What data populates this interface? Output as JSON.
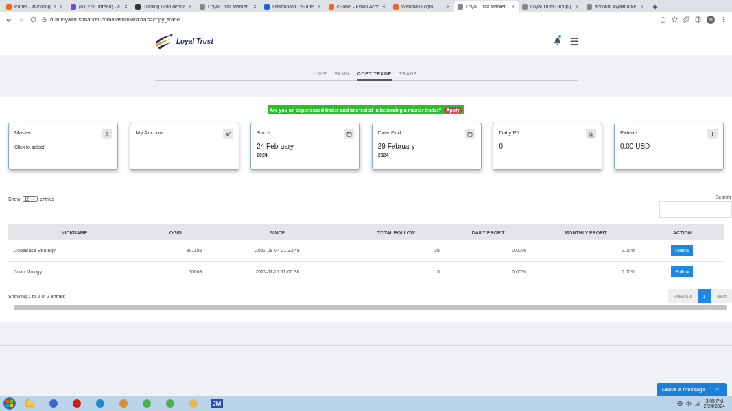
{
  "browser": {
    "tabs": [
      {
        "title": "Paper - Invoicing, In",
        "selected": false
      },
      {
        "title": "(61,221 unread) - a",
        "selected": false
      },
      {
        "title": "Trading Gold denga",
        "selected": false
      },
      {
        "title": "Loyal Trust Market",
        "selected": false
      },
      {
        "title": "Dashboard | hPanel",
        "selected": false
      },
      {
        "title": "cPanel - Email Acco",
        "selected": false
      },
      {
        "title": "Webmail Login",
        "selected": false
      },
      {
        "title": "Loyal Trust Market",
        "selected": true
      },
      {
        "title": "Loyal Trust Group |",
        "selected": false
      },
      {
        "title": "account.loyalmarke",
        "selected": false
      }
    ],
    "url": "hub.loyaltrustmarket.com/dashboard?tab=copy_trade",
    "profile": "M"
  },
  "header": {
    "brand": "Loyal Trust"
  },
  "nav": [
    {
      "label": "LIVE",
      "selected": false
    },
    {
      "label": "PAMM",
      "selected": false
    },
    {
      "label": "COPY TRADE",
      "selected": true
    },
    {
      "label": "TRADE",
      "selected": false
    }
  ],
  "banner": {
    "text": "Are you an experienced trader and interested in becoming a master trader?",
    "button": "Apply"
  },
  "cards": [
    {
      "title": "Master",
      "value": "Click to select",
      "kind": "user"
    },
    {
      "title": "My Account",
      "value": "-",
      "kind": "rocket"
    },
    {
      "title": "Since",
      "value": "24 February",
      "sub": "2024",
      "kind": "calendar"
    },
    {
      "title": "Date End",
      "value": "29 February",
      "sub": "2024",
      "kind": "calendar"
    },
    {
      "title": "Daily P/L",
      "value": "0",
      "kind": "chart"
    },
    {
      "title": "Extend",
      "value": "0.00 USD",
      "kind": "plus"
    }
  ],
  "table": {
    "show_label": "Show",
    "page_size": "10",
    "entries_label": "entries",
    "search_label": "Search:",
    "columns": [
      "NICKNAME",
      "LOGIN",
      "SINCE",
      "TOTAL FOLLOW",
      "DAILY PROFIT",
      "MONTHLY PROFIT",
      "ACTION"
    ],
    "rows": [
      {
        "nickname": "CodeBase Strategy",
        "login": "901152",
        "since": "2023-08-04 21:33:45",
        "total_follow": "36",
        "daily_profit": "0.00%",
        "monthly_profit": "0.00%",
        "action": "Follow"
      },
      {
        "nickname": "Cuan Mology",
        "login": "50069",
        "since": "2023-11-21 11:00:38",
        "total_follow": "5",
        "daily_profit": "0.00%",
        "monthly_profit": "0.00%",
        "action": "Follow"
      }
    ],
    "info": "Showing 1 to 2 of 2 entries",
    "pagination": [
      {
        "label": "Previous",
        "selected": false,
        "disabled": true
      },
      {
        "label": "1",
        "selected": true,
        "disabled": false
      },
      {
        "label": "Next",
        "selected": false,
        "disabled": true
      }
    ]
  },
  "chat": {
    "label": "Leave a message"
  },
  "taskbar": {
    "app_label": "JM",
    "time": "3:05 PM",
    "date": "2/24/2024"
  }
}
